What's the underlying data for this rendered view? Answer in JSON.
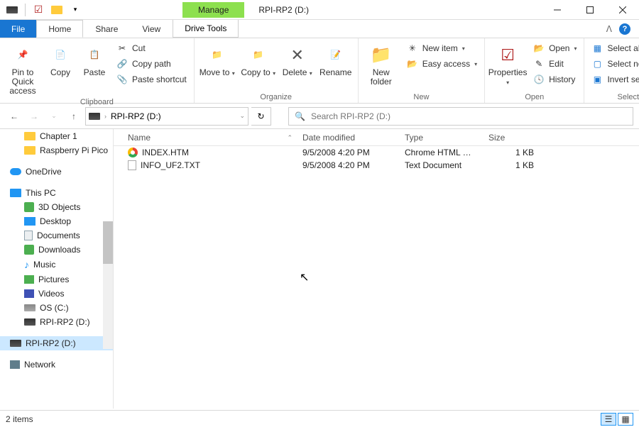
{
  "window": {
    "title": "RPI-RP2 (D:)",
    "manage_tab": "Manage"
  },
  "tabs": {
    "file": "File",
    "home": "Home",
    "share": "Share",
    "view": "View",
    "drive_tools": "Drive Tools"
  },
  "ribbon": {
    "clipboard": {
      "label": "Clipboard",
      "pin": "Pin to Quick access",
      "copy": "Copy",
      "paste": "Paste",
      "cut": "Cut",
      "copy_path": "Copy path",
      "paste_shortcut": "Paste shortcut"
    },
    "organize": {
      "label": "Organize",
      "move_to": "Move to",
      "copy_to": "Copy to",
      "delete": "Delete",
      "rename": "Rename"
    },
    "new_group": {
      "label": "New",
      "new_folder": "New folder",
      "new_item": "New item",
      "easy_access": "Easy access"
    },
    "open_group": {
      "label": "Open",
      "properties": "Properties",
      "open": "Open",
      "edit": "Edit",
      "history": "History"
    },
    "select_group": {
      "label": "Select",
      "select_all": "Select all",
      "select_none": "Select none",
      "invert": "Invert selection"
    }
  },
  "address": {
    "path": "RPI-RP2 (D:)"
  },
  "search": {
    "placeholder": "Search RPI-RP2 (D:)"
  },
  "nav": {
    "chapter1": "Chapter 1",
    "rpi_pico": "Raspberry Pi Pico",
    "onedrive": "OneDrive",
    "this_pc": "This PC",
    "objects3d": "3D Objects",
    "desktop": "Desktop",
    "documents": "Documents",
    "downloads": "Downloads",
    "music": "Music",
    "pictures": "Pictures",
    "videos": "Videos",
    "os_c": "OS (C:)",
    "rpi_d": "RPI-RP2 (D:)",
    "rpi_d2": "RPI-RP2 (D:)",
    "network": "Network"
  },
  "columns": {
    "name": "Name",
    "date": "Date modified",
    "type": "Type",
    "size": "Size"
  },
  "files": [
    {
      "name": "INDEX.HTM",
      "date": "9/5/2008 4:20 PM",
      "type": "Chrome HTML Do...",
      "size": "1 KB",
      "icon": "chrome"
    },
    {
      "name": "INFO_UF2.TXT",
      "date": "9/5/2008 4:20 PM",
      "type": "Text Document",
      "size": "1 KB",
      "icon": "txt"
    }
  ],
  "status": {
    "items": "2 items"
  }
}
